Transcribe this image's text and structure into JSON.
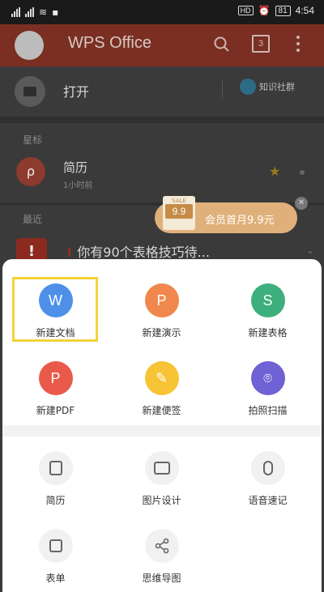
{
  "status": {
    "time": "4:54",
    "battery": "81",
    "hd": "HD"
  },
  "header": {
    "title": "WPS Office",
    "tabs_count": "3"
  },
  "list": {
    "open_label": "打开",
    "community_label": "知识社群",
    "starred_label": "星标",
    "starred_item": {
      "name": "简历",
      "time": "1小时前"
    },
    "recent_label": "最近",
    "recent_item": {
      "mark": "!",
      "text": "你有90个表格技巧待..."
    }
  },
  "promo": {
    "tag_small": "SALE",
    "price": "9.9",
    "text": "会员首月9.9元"
  },
  "sheet": {
    "create_row1": [
      {
        "label": "新建文档",
        "glyph": "W"
      },
      {
        "label": "新建演示",
        "glyph": "P"
      },
      {
        "label": "新建表格",
        "glyph": "S"
      }
    ],
    "create_row2": [
      {
        "label": "新建PDF",
        "glyph": "P"
      },
      {
        "label": "新建便签",
        "glyph": "✎"
      },
      {
        "label": "拍照扫描",
        "glyph": "⌾"
      }
    ],
    "tools_row1": [
      {
        "label": "简历"
      },
      {
        "label": "图片设计"
      },
      {
        "label": "语音速记"
      }
    ],
    "tools_row2": [
      {
        "label": "表单"
      },
      {
        "label": "思维导图"
      }
    ]
  },
  "colors": {
    "doc": "#4e90e8",
    "ppt": "#f0874c",
    "sheet": "#3daf7c",
    "pdf": "#e95a4a",
    "note": "#f6c434",
    "scan": "#6f62d4",
    "highlight": "#f3d23a",
    "header": "#7a2f22"
  },
  "icons": [
    "search-icon",
    "tabs-icon",
    "more-vert-icon",
    "folder-icon",
    "community-icon",
    "star-icon",
    "close-icon"
  ]
}
